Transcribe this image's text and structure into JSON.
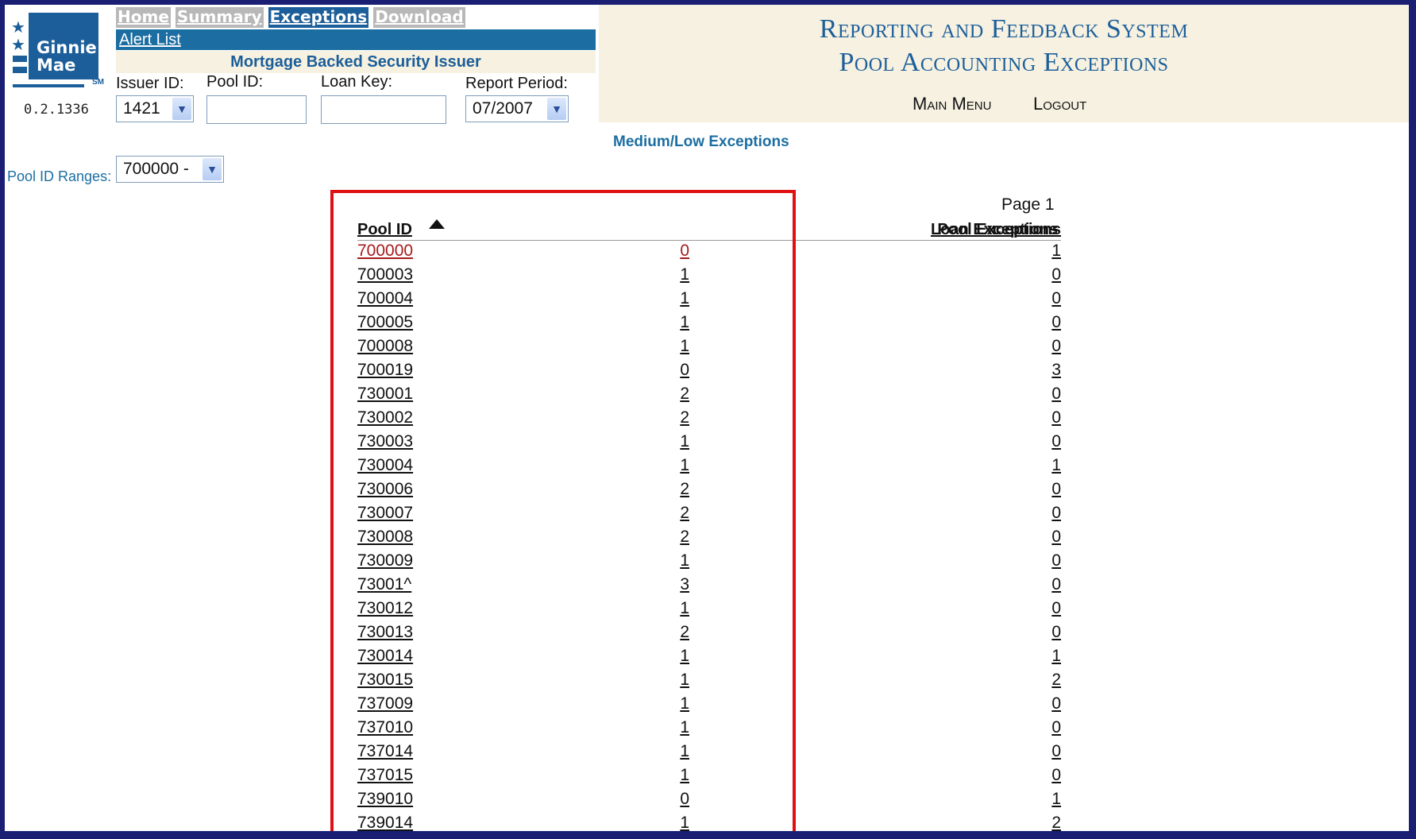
{
  "logo": {
    "line1": "Ginnie",
    "line2": "Mae",
    "sm": "SM"
  },
  "version": "0.2.1336",
  "nav": {
    "items": [
      {
        "label": "Home",
        "active": false
      },
      {
        "label": "Summary",
        "active": false
      },
      {
        "label": "Exceptions",
        "active": true
      },
      {
        "label": "Download",
        "active": false
      }
    ],
    "alert_link": "Alert List"
  },
  "issuer_title": "Mortgage Backed Security Issuer",
  "filters": {
    "issuer_id_label": "Issuer ID:",
    "issuer_id_value": "1421",
    "pool_id_label": "Pool ID:",
    "pool_id_value": "",
    "loan_key_label": "Loan Key:",
    "loan_key_value": "",
    "report_period_label": "Report Period:",
    "report_period_value": "07/2007",
    "pool_range_label": "Pool ID Ranges:",
    "pool_range_value": "700000 -"
  },
  "header": {
    "title_line1": "Reporting and Feedback System",
    "title_line2": "Pool Accounting Exceptions",
    "main_menu": "Main Menu",
    "logout": "Logout"
  },
  "subtitle": "Medium/Low Exceptions",
  "page_label": "Page 1",
  "table": {
    "headers": {
      "pool_id": "Pool ID",
      "pool_exceptions": "Pool Exceptions",
      "loan_exceptions": "Loan Exceptions"
    },
    "sort": "ascending",
    "rows": [
      {
        "pool_id": "700000",
        "pool_exceptions": "0",
        "loan_exceptions": "1",
        "visited": true
      },
      {
        "pool_id": "700003",
        "pool_exceptions": "1",
        "loan_exceptions": "0",
        "visited": false
      },
      {
        "pool_id": "700004",
        "pool_exceptions": "1",
        "loan_exceptions": "0",
        "visited": false
      },
      {
        "pool_id": "700005",
        "pool_exceptions": "1",
        "loan_exceptions": "0",
        "visited": false
      },
      {
        "pool_id": "700008",
        "pool_exceptions": "1",
        "loan_exceptions": "0",
        "visited": false
      },
      {
        "pool_id": "700019",
        "pool_exceptions": "0",
        "loan_exceptions": "3",
        "visited": false
      },
      {
        "pool_id": "730001",
        "pool_exceptions": "2",
        "loan_exceptions": "0",
        "visited": false
      },
      {
        "pool_id": "730002",
        "pool_exceptions": "2",
        "loan_exceptions": "0",
        "visited": false
      },
      {
        "pool_id": "730003",
        "pool_exceptions": "1",
        "loan_exceptions": "0",
        "visited": false
      },
      {
        "pool_id": "730004",
        "pool_exceptions": "1",
        "loan_exceptions": "1",
        "visited": false
      },
      {
        "pool_id": "730006",
        "pool_exceptions": "2",
        "loan_exceptions": "0",
        "visited": false
      },
      {
        "pool_id": "730007",
        "pool_exceptions": "2",
        "loan_exceptions": "0",
        "visited": false
      },
      {
        "pool_id": "730008",
        "pool_exceptions": "2",
        "loan_exceptions": "0",
        "visited": false
      },
      {
        "pool_id": "730009",
        "pool_exceptions": "1",
        "loan_exceptions": "0",
        "visited": false
      },
      {
        "pool_id": "73001^",
        "pool_exceptions": "3",
        "loan_exceptions": "0",
        "visited": false
      },
      {
        "pool_id": "730012",
        "pool_exceptions": "1",
        "loan_exceptions": "0",
        "visited": false
      },
      {
        "pool_id": "730013",
        "pool_exceptions": "2",
        "loan_exceptions": "0",
        "visited": false
      },
      {
        "pool_id": "730014",
        "pool_exceptions": "1",
        "loan_exceptions": "1",
        "visited": false
      },
      {
        "pool_id": "730015",
        "pool_exceptions": "1",
        "loan_exceptions": "2",
        "visited": false
      },
      {
        "pool_id": "737009",
        "pool_exceptions": "1",
        "loan_exceptions": "0",
        "visited": false
      },
      {
        "pool_id": "737010",
        "pool_exceptions": "1",
        "loan_exceptions": "0",
        "visited": false
      },
      {
        "pool_id": "737014",
        "pool_exceptions": "1",
        "loan_exceptions": "0",
        "visited": false
      },
      {
        "pool_id": "737015",
        "pool_exceptions": "1",
        "loan_exceptions": "0",
        "visited": false
      },
      {
        "pool_id": "739010",
        "pool_exceptions": "0",
        "loan_exceptions": "1",
        "visited": false
      },
      {
        "pool_id": "739014",
        "pool_exceptions": "1",
        "loan_exceptions": "2",
        "visited": false
      }
    ]
  },
  "colors": {
    "brand_blue": "#1c5e99",
    "link_blue": "#1c6ea2",
    "header_bg": "#f6f1e1",
    "highlight_red": "#e01010",
    "visited_red": "#a61c1c",
    "outer_frame": "#1a1f74"
  }
}
